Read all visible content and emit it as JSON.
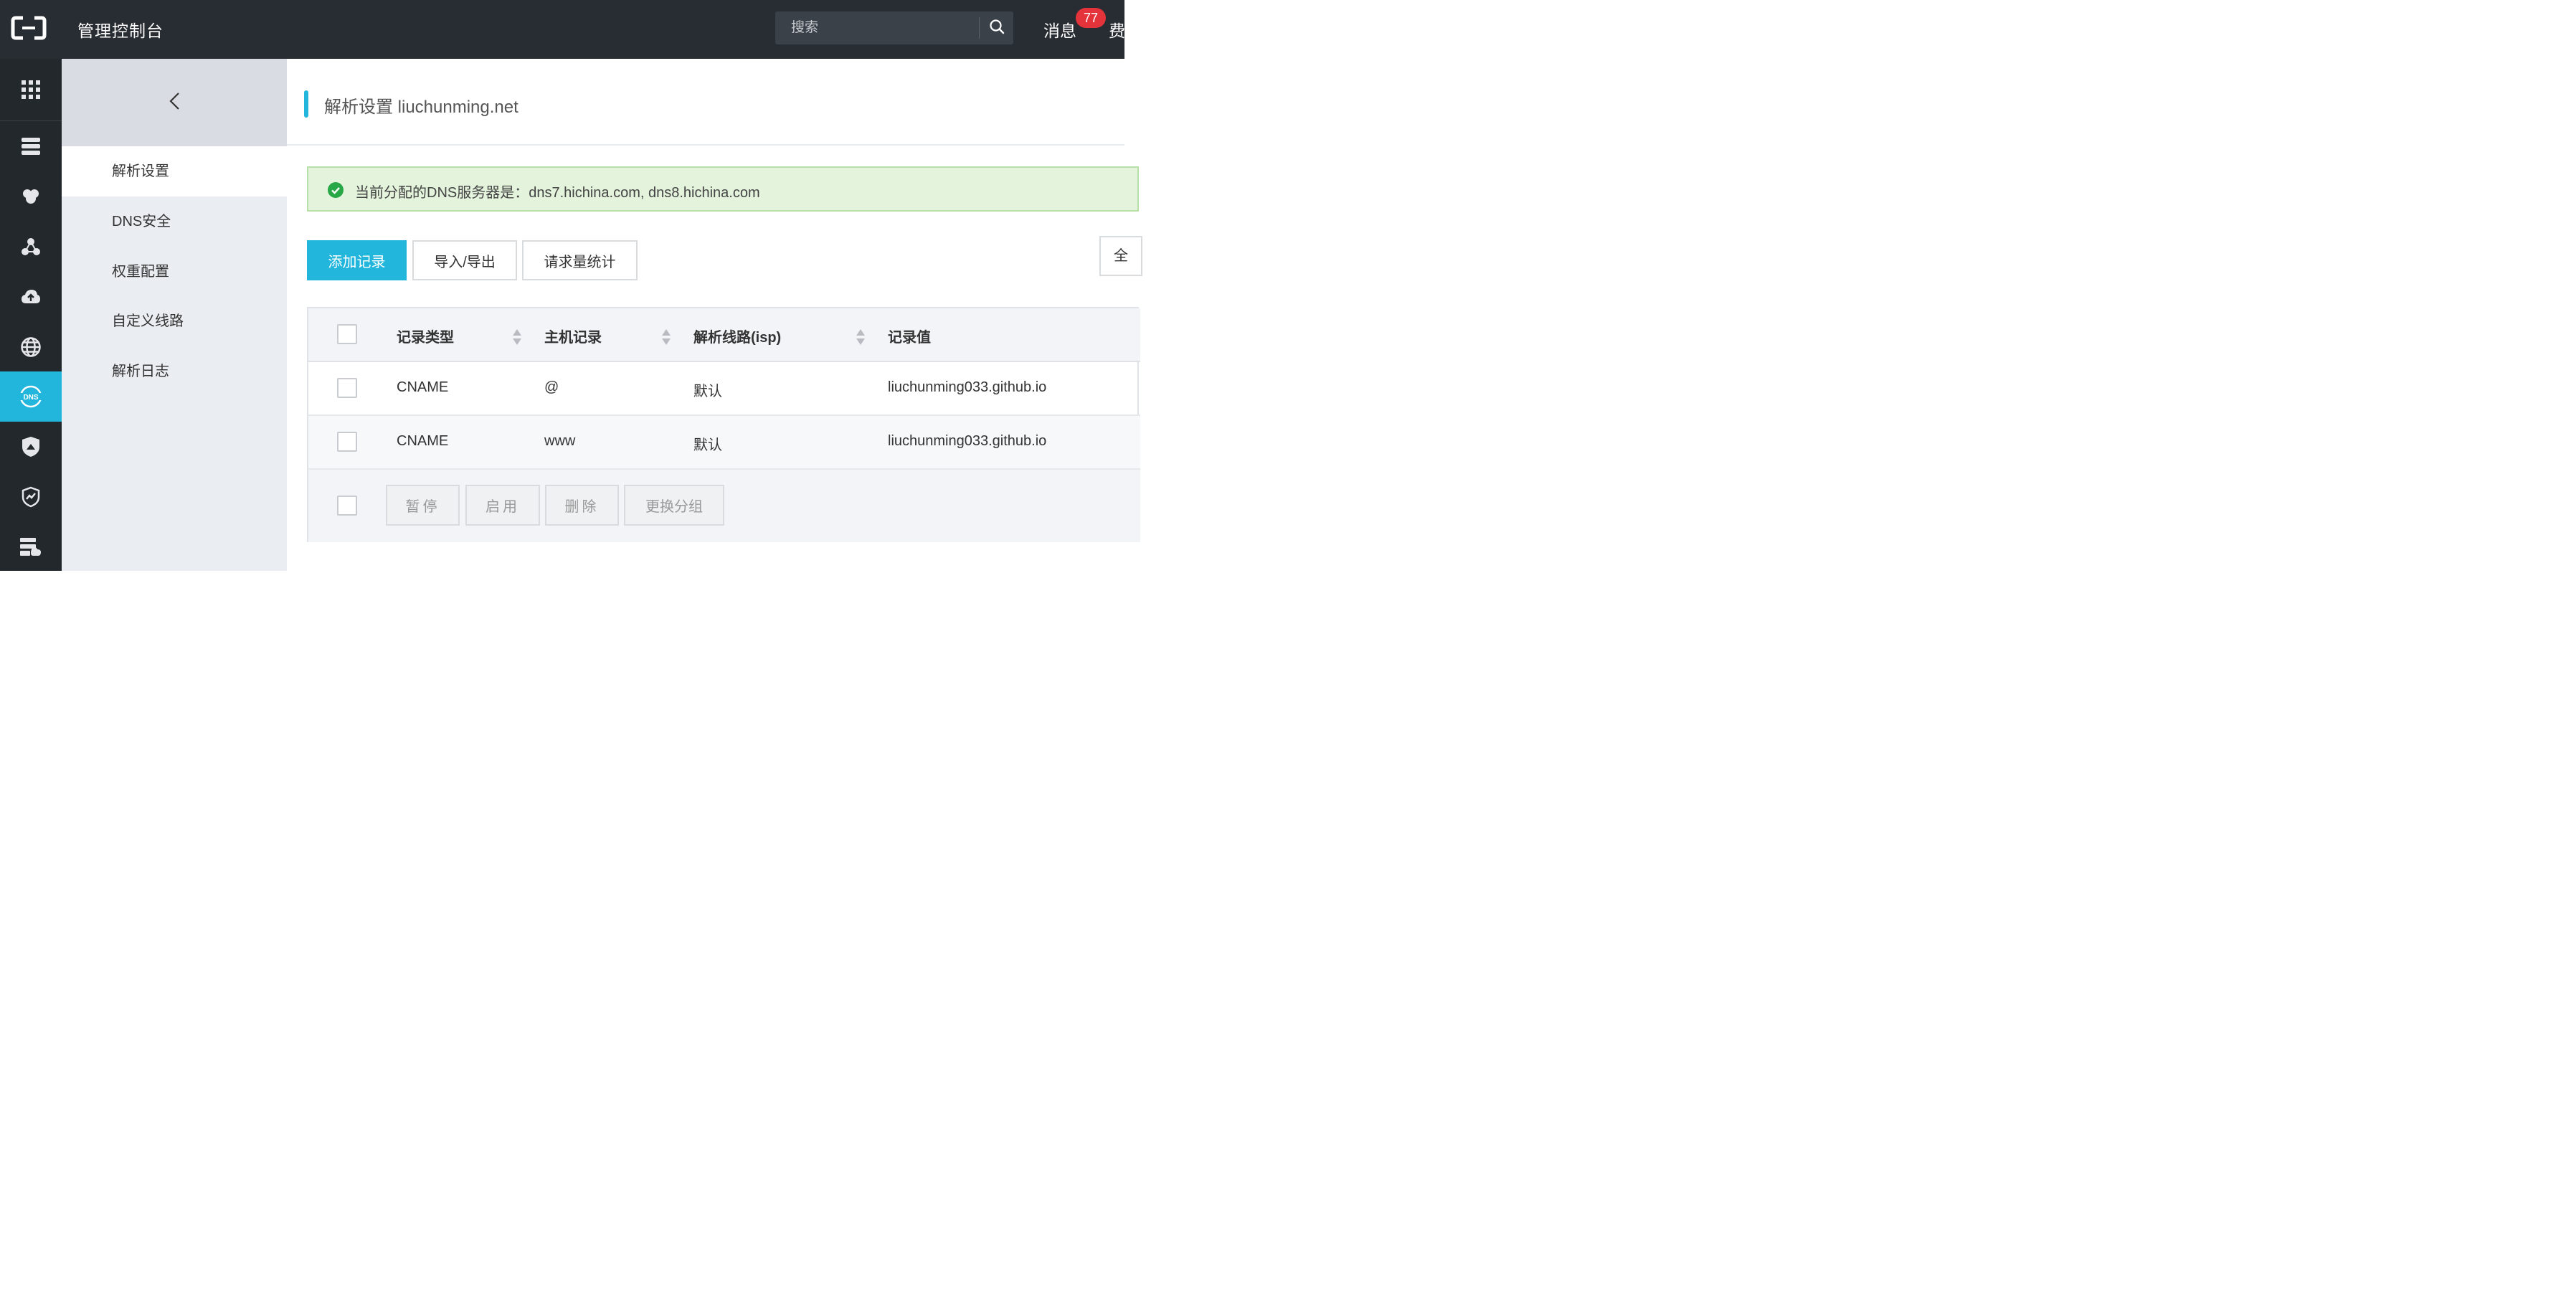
{
  "header": {
    "title": "管理控制台",
    "search_placeholder": "搜索",
    "messages_label": "消息",
    "messages_count": "77",
    "fee_label": "费"
  },
  "rail": {
    "items": [
      "apps-grid-icon",
      "database-icon",
      "cloud-compute-icon",
      "network-icon",
      "cloud-upload-icon",
      "globe-icon",
      "dns-icon",
      "security-shield-icon",
      "monitor-shield-icon",
      "server-storage-icon"
    ],
    "active": "dns-icon"
  },
  "subnav": {
    "items": [
      {
        "label": "解析设置",
        "active": true
      },
      {
        "label": "DNS安全",
        "active": false
      },
      {
        "label": "权重配置",
        "active": false
      },
      {
        "label": "自定义线路",
        "active": false
      },
      {
        "label": "解析日志",
        "active": false
      }
    ]
  },
  "main": {
    "title": "解析设置 liuchunming.net",
    "alert_text": "当前分配的DNS服务器是：dns7.hichina.com, dns8.hichina.com",
    "actions": {
      "add_record": "添加记录",
      "import_export": "导入/导出",
      "request_stats": "请求量统计",
      "all": "全"
    },
    "table": {
      "columns": [
        "记录类型",
        "主机记录",
        "解析线路(isp)",
        "记录值"
      ],
      "rows": [
        {
          "type": "CNAME",
          "host": "@",
          "line": "默认",
          "value": "liuchunming033.github.io"
        },
        {
          "type": "CNAME",
          "host": "www",
          "line": "默认",
          "value": "liuchunming033.github.io"
        }
      ],
      "footer_buttons": [
        "暂停",
        "启用",
        "删除",
        "更换分组"
      ]
    }
  },
  "colors": {
    "topbar": "#282d33",
    "rail": "#23282d",
    "accent": "#22b6dc",
    "alert_bg": "#e3f3dc",
    "badge": "#e5333b"
  }
}
